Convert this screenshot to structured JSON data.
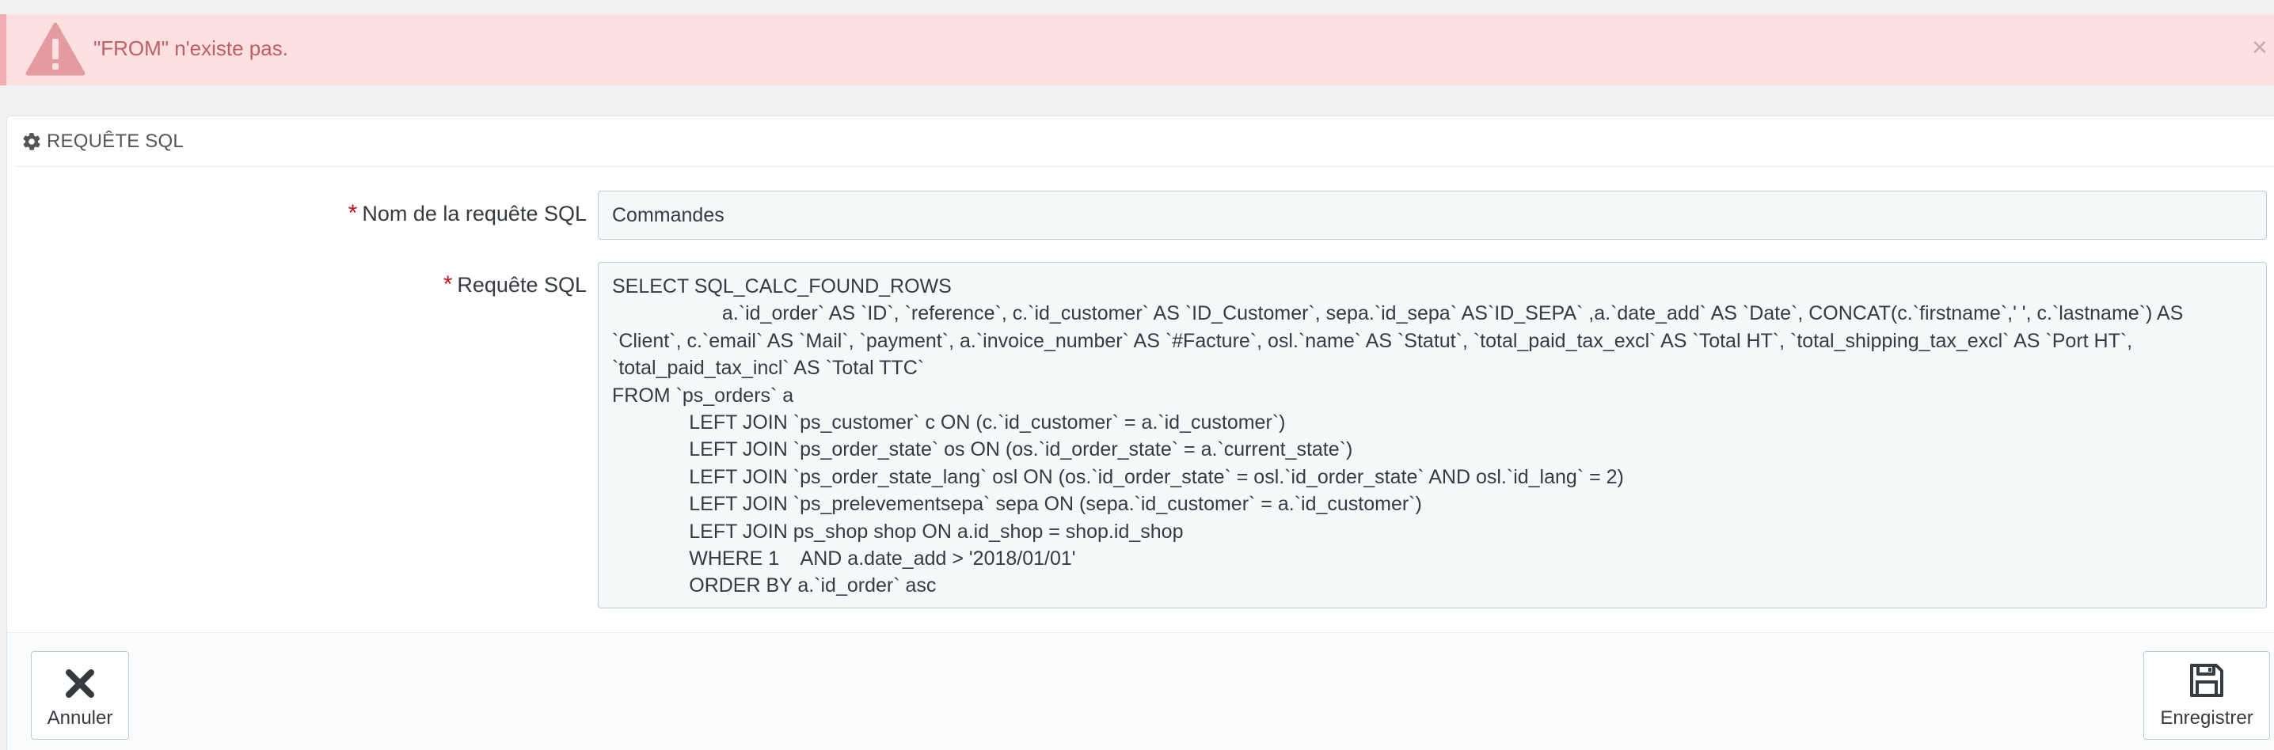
{
  "alert": {
    "message": "\"FROM\" n'existe pas.",
    "close_label": "×",
    "icon": "warning-triangle-icon",
    "color": "#c05c67"
  },
  "panel": {
    "icon": "gear-icon",
    "title": "REQUÊTE SQL"
  },
  "form": {
    "name": {
      "required_mark": "*",
      "label": "Nom de la requête SQL",
      "value": "Commandes"
    },
    "sql": {
      "required_mark": "*",
      "label": "Requête SQL",
      "value": "SELECT SQL_CALC_FOUND_ROWS\n                    a.`id_order` AS `ID`, `reference`, c.`id_customer` AS `ID_Customer`, sepa.`id_sepa` AS`ID_SEPA` ,a.`date_add` AS `Date`, CONCAT(c.`firstname`,' ', c.`lastname`) AS `Client`, c.`email` AS `Mail`, `payment`, a.`invoice_number` AS `#Facture`, osl.`name` AS `Statut`, `total_paid_tax_excl` AS `Total HT`, `total_shipping_tax_excl` AS `Port HT`, `total_paid_tax_incl` AS `Total TTC`\nFROM `ps_orders` a\n              LEFT JOIN `ps_customer` c ON (c.`id_customer` = a.`id_customer`)\n              LEFT JOIN `ps_order_state` os ON (os.`id_order_state` = a.`current_state`)\n              LEFT JOIN `ps_order_state_lang` osl ON (os.`id_order_state` = osl.`id_order_state` AND osl.`id_lang` = 2)\n              LEFT JOIN `ps_prelevementsepa` sepa ON (sepa.`id_customer` = a.`id_customer`)\n              LEFT JOIN ps_shop shop ON a.id_shop = shop.id_shop\n              WHERE 1    AND a.date_add > '2018/01/01'\n              ORDER BY a.`id_order` asc"
    }
  },
  "footer": {
    "cancel": {
      "label": "Annuler",
      "icon": "close-x-icon"
    },
    "save": {
      "label": "Enregistrer",
      "icon": "floppy-disk-icon"
    }
  }
}
